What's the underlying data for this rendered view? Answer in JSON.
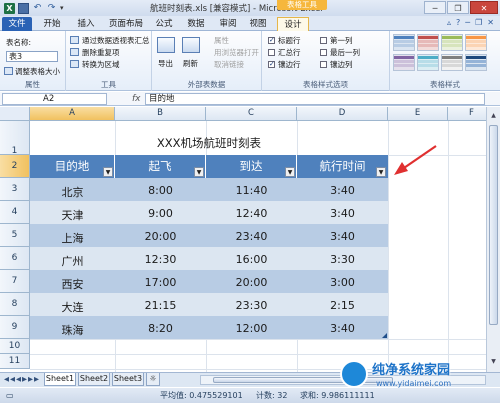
{
  "window": {
    "title": "航班时刻表.xls [兼容模式] - Microsoft Excel",
    "contextual_tab_group": "表格工具",
    "buttons": {
      "minimize": "─",
      "restore": "❐",
      "close": "✕"
    }
  },
  "ribbon_tabs": [
    {
      "label": "文件"
    },
    {
      "label": "开始"
    },
    {
      "label": "插入"
    },
    {
      "label": "页面布局"
    },
    {
      "label": "公式"
    },
    {
      "label": "数据"
    },
    {
      "label": "审阅"
    },
    {
      "label": "视图"
    },
    {
      "label": "设计",
      "active": true
    }
  ],
  "ribbon": {
    "properties": {
      "table_name_label": "表名称:",
      "table_name_value": "表3",
      "resize_table": "调整表格大小",
      "group_label": "属性"
    },
    "tools": {
      "pivot": "通过数据透视表汇总",
      "remove_duplicates": "删除重复项",
      "convert_to_range": "转换为区域",
      "group_label": "工具"
    },
    "external": {
      "export": "导出",
      "refresh": "刷新",
      "properties": "属性",
      "open_in_browser": "用浏览器打开",
      "unlink": "取消链接",
      "group_label": "外部表数据"
    },
    "style_options": {
      "header_row": "标题行",
      "first_column": "第一列",
      "total_row": "汇总行",
      "last_column": "最后一列",
      "banded_rows": "镶边行",
      "banded_columns": "镶边列",
      "group_label": "表格样式选项"
    },
    "styles": {
      "group_label": "表格样式"
    }
  },
  "formula_bar": {
    "name_box": "A2",
    "fx": "fx",
    "content": "目的地"
  },
  "columns": [
    "A",
    "B",
    "C",
    "D",
    "E",
    "F"
  ],
  "rows": [
    "1",
    "2",
    "3",
    "4",
    "5",
    "6",
    "7",
    "8",
    "9",
    "10",
    "11"
  ],
  "sheet": {
    "title": "XXX机场航班时刻表",
    "headers": [
      "目的地",
      "起飞",
      "到达",
      "航行时间"
    ],
    "data": [
      [
        "北京",
        "8:00",
        "11:40",
        "3:40"
      ],
      [
        "天津",
        "9:00",
        "12:40",
        "3:40"
      ],
      [
        "上海",
        "20:00",
        "23:40",
        "3:40"
      ],
      [
        "广州",
        "12:30",
        "16:00",
        "3:30"
      ],
      [
        "西安",
        "17:00",
        "20:00",
        "3:00"
      ],
      [
        "大连",
        "21:15",
        "23:30",
        "2:15"
      ],
      [
        "珠海",
        "8:20",
        "12:00",
        "3:40"
      ]
    ]
  },
  "sheet_tabs": [
    "Sheet1",
    "Sheet2",
    "Sheet3"
  ],
  "status_bar": {
    "average": "平均值: 0.475529101",
    "count": "计数: 32",
    "sum": "求和: 9.986111111"
  },
  "colors": {
    "table_header": "#4f81bd",
    "band_dark": "#b8cce4",
    "band_light": "#dce6f1",
    "annotation_arrow": "#e03030"
  },
  "watermark": {
    "title": "纯净系统家园",
    "url": "www.yidaimei.com"
  }
}
